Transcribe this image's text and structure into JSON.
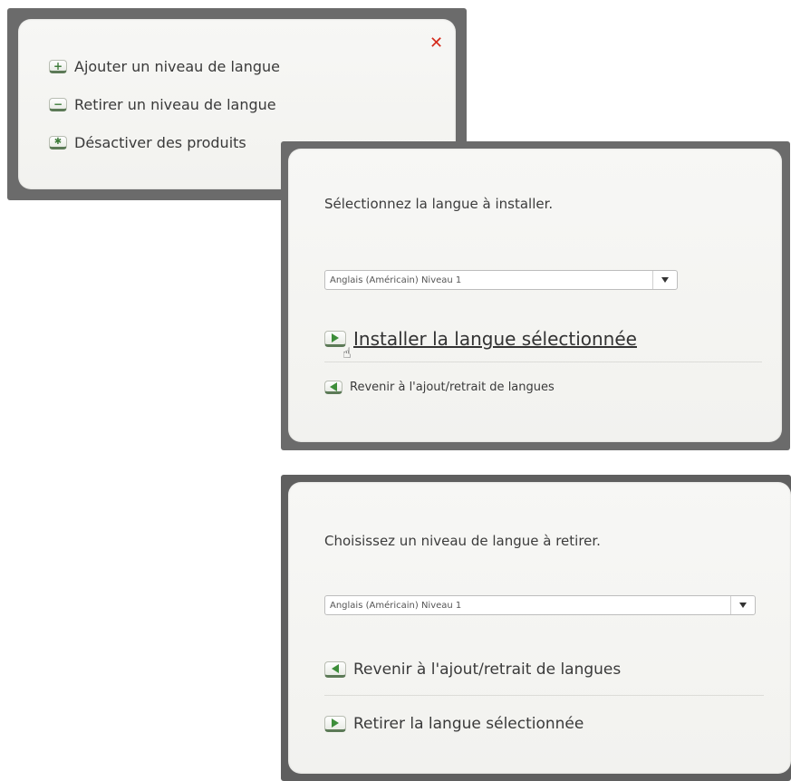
{
  "menu_panel": {
    "items": [
      {
        "label": "Ajouter un niveau de langue",
        "icon": "plus-icon",
        "glyph": "+"
      },
      {
        "label": "Retirer un niveau de langue",
        "icon": "minus-icon",
        "glyph": "−"
      },
      {
        "label": "Désactiver des produits",
        "icon": "asterisk-icon",
        "glyph": "✱"
      }
    ],
    "close_glyph": "✕"
  },
  "install_panel": {
    "prompt": "Sélectionnez la langue à installer.",
    "select_value": "Anglais (Américain) Niveau 1",
    "install_link": "Installer la langue sélectionnée",
    "back_link": "Revenir à l'ajout/retrait de langues"
  },
  "remove_panel": {
    "prompt": "Choisissez un niveau de langue à retirer.",
    "select_value": "Anglais (Américain) Niveau 1",
    "back_link": "Revenir à l'ajout/retrait de langues",
    "remove_link": "Retirer la langue sélectionnée"
  },
  "colors": {
    "frame": "#6b6b6b",
    "accent_green": "#3d8e3a",
    "close_red": "#d42a1b"
  }
}
